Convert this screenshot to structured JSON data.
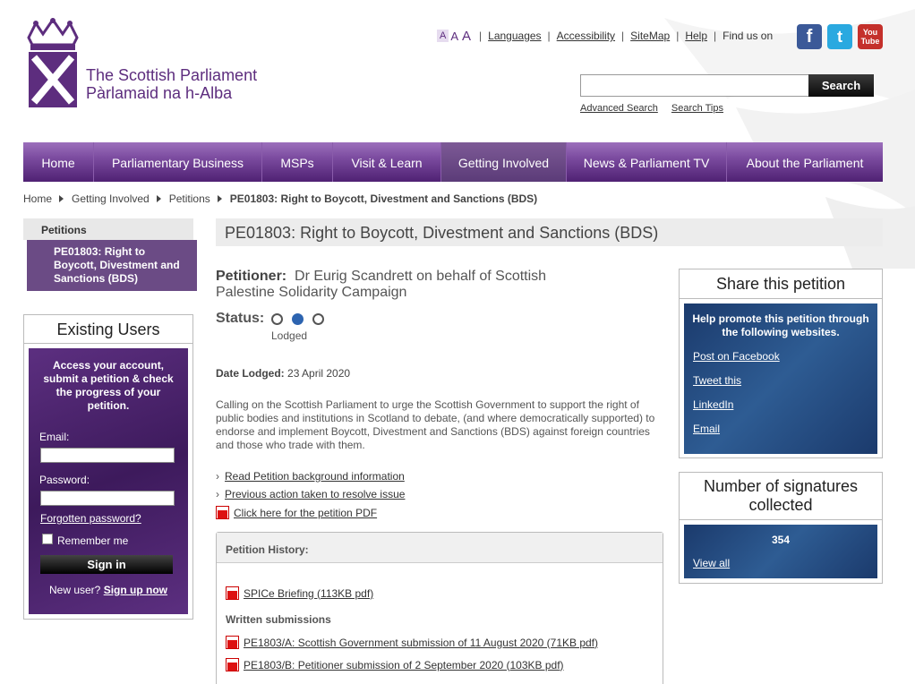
{
  "header": {
    "logo_line1": "The Scottish Parliament",
    "logo_line2": "Pàrlamaid na h-Alba",
    "font_sizes": [
      "A",
      "A",
      "A"
    ],
    "links": [
      "Languages",
      "Accessibility",
      "SiteMap",
      "Help"
    ],
    "find_us": "Find us on",
    "social": {
      "facebook": "f",
      "twitter": "t",
      "youtube_1": "You",
      "youtube_2": "Tube"
    },
    "search_placeholder": "",
    "search_button": "Search",
    "advanced_search": "Advanced Search",
    "search_tips": "Search Tips"
  },
  "nav": {
    "items": [
      "Home",
      "Parliamentary Business",
      "MSPs",
      "Visit & Learn",
      "Getting Involved",
      "News & Parliament TV",
      "About the Parliament"
    ],
    "active": "Getting Involved"
  },
  "breadcrumb": [
    "Home",
    "Getting Involved",
    "Petitions",
    "PE01803: Right to Boycott, Divestment and Sanctions (BDS)"
  ],
  "sidebar": {
    "heading": "Petitions",
    "selected": "PE01803: Right to Boycott, Divestment and Sanctions (BDS)"
  },
  "login": {
    "title": "Existing Users",
    "intro": "Access your account, submit a petition & check the progress of your petition.",
    "email_label": "Email:",
    "password_label": "Password:",
    "forgot": "Forgotten password?",
    "remember": "Remember me",
    "signin": "Sign in",
    "new_user": "New user?",
    "signup": "Sign up now"
  },
  "petition": {
    "title": "PE01803: Right to Boycott, Divestment and Sanctions (BDS)",
    "petitioner_label": "Petitioner:",
    "petitioner": "Dr Eurig Scandrett on behalf of Scottish Palestine Solidarity Campaign",
    "status_label": "Status:",
    "status_stage": "Lodged",
    "date_label": "Date Lodged:",
    "date": "23 April 2020",
    "description": "Calling on the Scottish Parliament to urge the Scottish Government to support the right of public bodies and institutions in Scotland to debate, (and where democratically supported) to endorse and implement Boycott, Divestment and Sanctions (BDS) against foreign countries and those who trade with them.",
    "links": [
      "Read Petition background information",
      "Previous action taken to resolve issue"
    ],
    "pdf_link": "Click here for the petition PDF"
  },
  "history": {
    "heading": "Petition History:",
    "spice": "SPICe Briefing (113KB pdf)",
    "written_heading": "Written submissions",
    "submissions": [
      "PE1803/A: Scottish Government submission of 11 August 2020 (71KB pdf)",
      "PE1803/B: Petitioner submission of 2 September 2020 (103KB pdf)"
    ]
  },
  "share": {
    "title": "Share this petition",
    "intro": "Help promote this petition through the following websites.",
    "links": [
      "Post on Facebook",
      "Tweet this",
      "LinkedIn",
      "Email"
    ]
  },
  "signatures": {
    "title": "Number of signatures collected",
    "count": "354",
    "view_all": "View all"
  },
  "colors": {
    "purple": "#5d2d7e",
    "nav_dark": "#4f2173",
    "blue_box": "#1b3a6c",
    "status_dot": "#2d64b0"
  }
}
